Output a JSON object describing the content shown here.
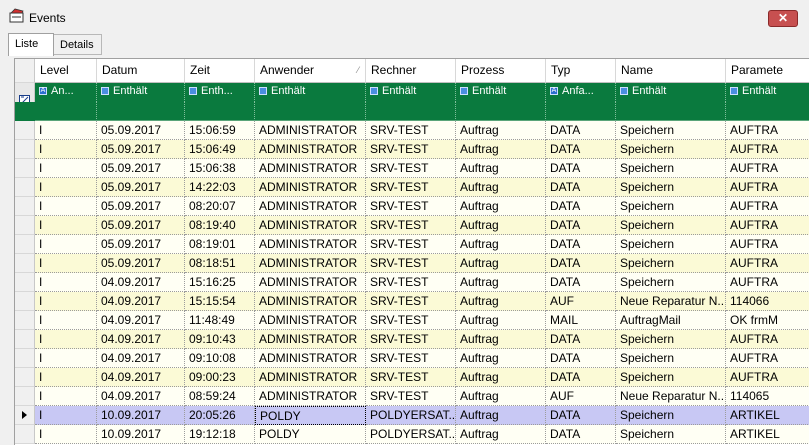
{
  "window": {
    "title": "Events",
    "close": "✕"
  },
  "tabs": [
    {
      "label": "Liste"
    },
    {
      "label": "Details"
    }
  ],
  "columns": [
    "Level",
    "Datum",
    "Zeit",
    "Anwender",
    "Rechner",
    "Prozess",
    "Typ",
    "Name",
    "Paramete"
  ],
  "filter": [
    {
      "icon": "A",
      "text": "An..."
    },
    {
      "icon": "",
      "text": "Enthält"
    },
    {
      "icon": "",
      "text": "Enth..."
    },
    {
      "icon": "",
      "text": "Enthält"
    },
    {
      "icon": "",
      "text": "Enthält"
    },
    {
      "icon": "",
      "text": "Enthält"
    },
    {
      "icon": "A",
      "text": "Anfa..."
    },
    {
      "icon": "",
      "text": "Enthält"
    },
    {
      "icon": "",
      "text": "Enthält"
    }
  ],
  "rows": [
    [
      "I",
      "05.09.2017",
      "15:06:59",
      "ADMINISTRATOR",
      "SRV-TEST",
      "Auftrag",
      "DATA",
      "Speichern",
      "AUFTRA"
    ],
    [
      "I",
      "05.09.2017",
      "15:06:49",
      "ADMINISTRATOR",
      "SRV-TEST",
      "Auftrag",
      "DATA",
      "Speichern",
      "AUFTRA"
    ],
    [
      "I",
      "05.09.2017",
      "15:06:38",
      "ADMINISTRATOR",
      "SRV-TEST",
      "Auftrag",
      "DATA",
      "Speichern",
      "AUFTRA"
    ],
    [
      "I",
      "05.09.2017",
      "14:22:03",
      "ADMINISTRATOR",
      "SRV-TEST",
      "Auftrag",
      "DATA",
      "Speichern",
      "AUFTRA"
    ],
    [
      "I",
      "05.09.2017",
      "08:20:07",
      "ADMINISTRATOR",
      "SRV-TEST",
      "Auftrag",
      "DATA",
      "Speichern",
      "AUFTRA"
    ],
    [
      "I",
      "05.09.2017",
      "08:19:40",
      "ADMINISTRATOR",
      "SRV-TEST",
      "Auftrag",
      "DATA",
      "Speichern",
      "AUFTRA"
    ],
    [
      "I",
      "05.09.2017",
      "08:19:01",
      "ADMINISTRATOR",
      "SRV-TEST",
      "Auftrag",
      "DATA",
      "Speichern",
      "AUFTRA"
    ],
    [
      "I",
      "05.09.2017",
      "08:18:51",
      "ADMINISTRATOR",
      "SRV-TEST",
      "Auftrag",
      "DATA",
      "Speichern",
      "AUFTRA"
    ],
    [
      "I",
      "04.09.2017",
      "15:16:25",
      "ADMINISTRATOR",
      "SRV-TEST",
      "Auftrag",
      "DATA",
      "Speichern",
      "AUFTRA"
    ],
    [
      "I",
      "04.09.2017",
      "15:15:54",
      "ADMINISTRATOR",
      "SRV-TEST",
      "Auftrag",
      "AUF",
      "Neue Reparatur N...",
      "114066"
    ],
    [
      "I",
      "04.09.2017",
      "11:48:49",
      "ADMINISTRATOR",
      "SRV-TEST",
      "Auftrag",
      "MAIL",
      "AuftragMail",
      "OK frmM"
    ],
    [
      "I",
      "04.09.2017",
      "09:10:43",
      "ADMINISTRATOR",
      "SRV-TEST",
      "Auftrag",
      "DATA",
      "Speichern",
      "AUFTRA"
    ],
    [
      "I",
      "04.09.2017",
      "09:10:08",
      "ADMINISTRATOR",
      "SRV-TEST",
      "Auftrag",
      "DATA",
      "Speichern",
      "AUFTRA"
    ],
    [
      "I",
      "04.09.2017",
      "09:00:23",
      "ADMINISTRATOR",
      "SRV-TEST",
      "Auftrag",
      "DATA",
      "Speichern",
      "AUFTRA"
    ],
    [
      "I",
      "04.09.2017",
      "08:59:24",
      "ADMINISTRATOR",
      "SRV-TEST",
      "Auftrag",
      "AUF",
      "Neue Reparatur N...",
      "114065"
    ],
    [
      "I",
      "10.09.2017",
      "20:05:26",
      "POLDY",
      "POLDYERSAT...",
      "Auftrag",
      "DATA",
      "Speichern",
      "ARTIKEL"
    ],
    [
      "I",
      "10.09.2017",
      "19:12:18",
      "POLDY",
      "POLDYERSAT...",
      "Auftrag",
      "DATA",
      "Speichern",
      "ARTIKEL"
    ]
  ],
  "selected_row": 15,
  "colors": {
    "filter_bg": "#0a7a3e",
    "row_odd": "#fffff4",
    "row_even": "#fbfad6",
    "selected": "#c8c8f4"
  }
}
